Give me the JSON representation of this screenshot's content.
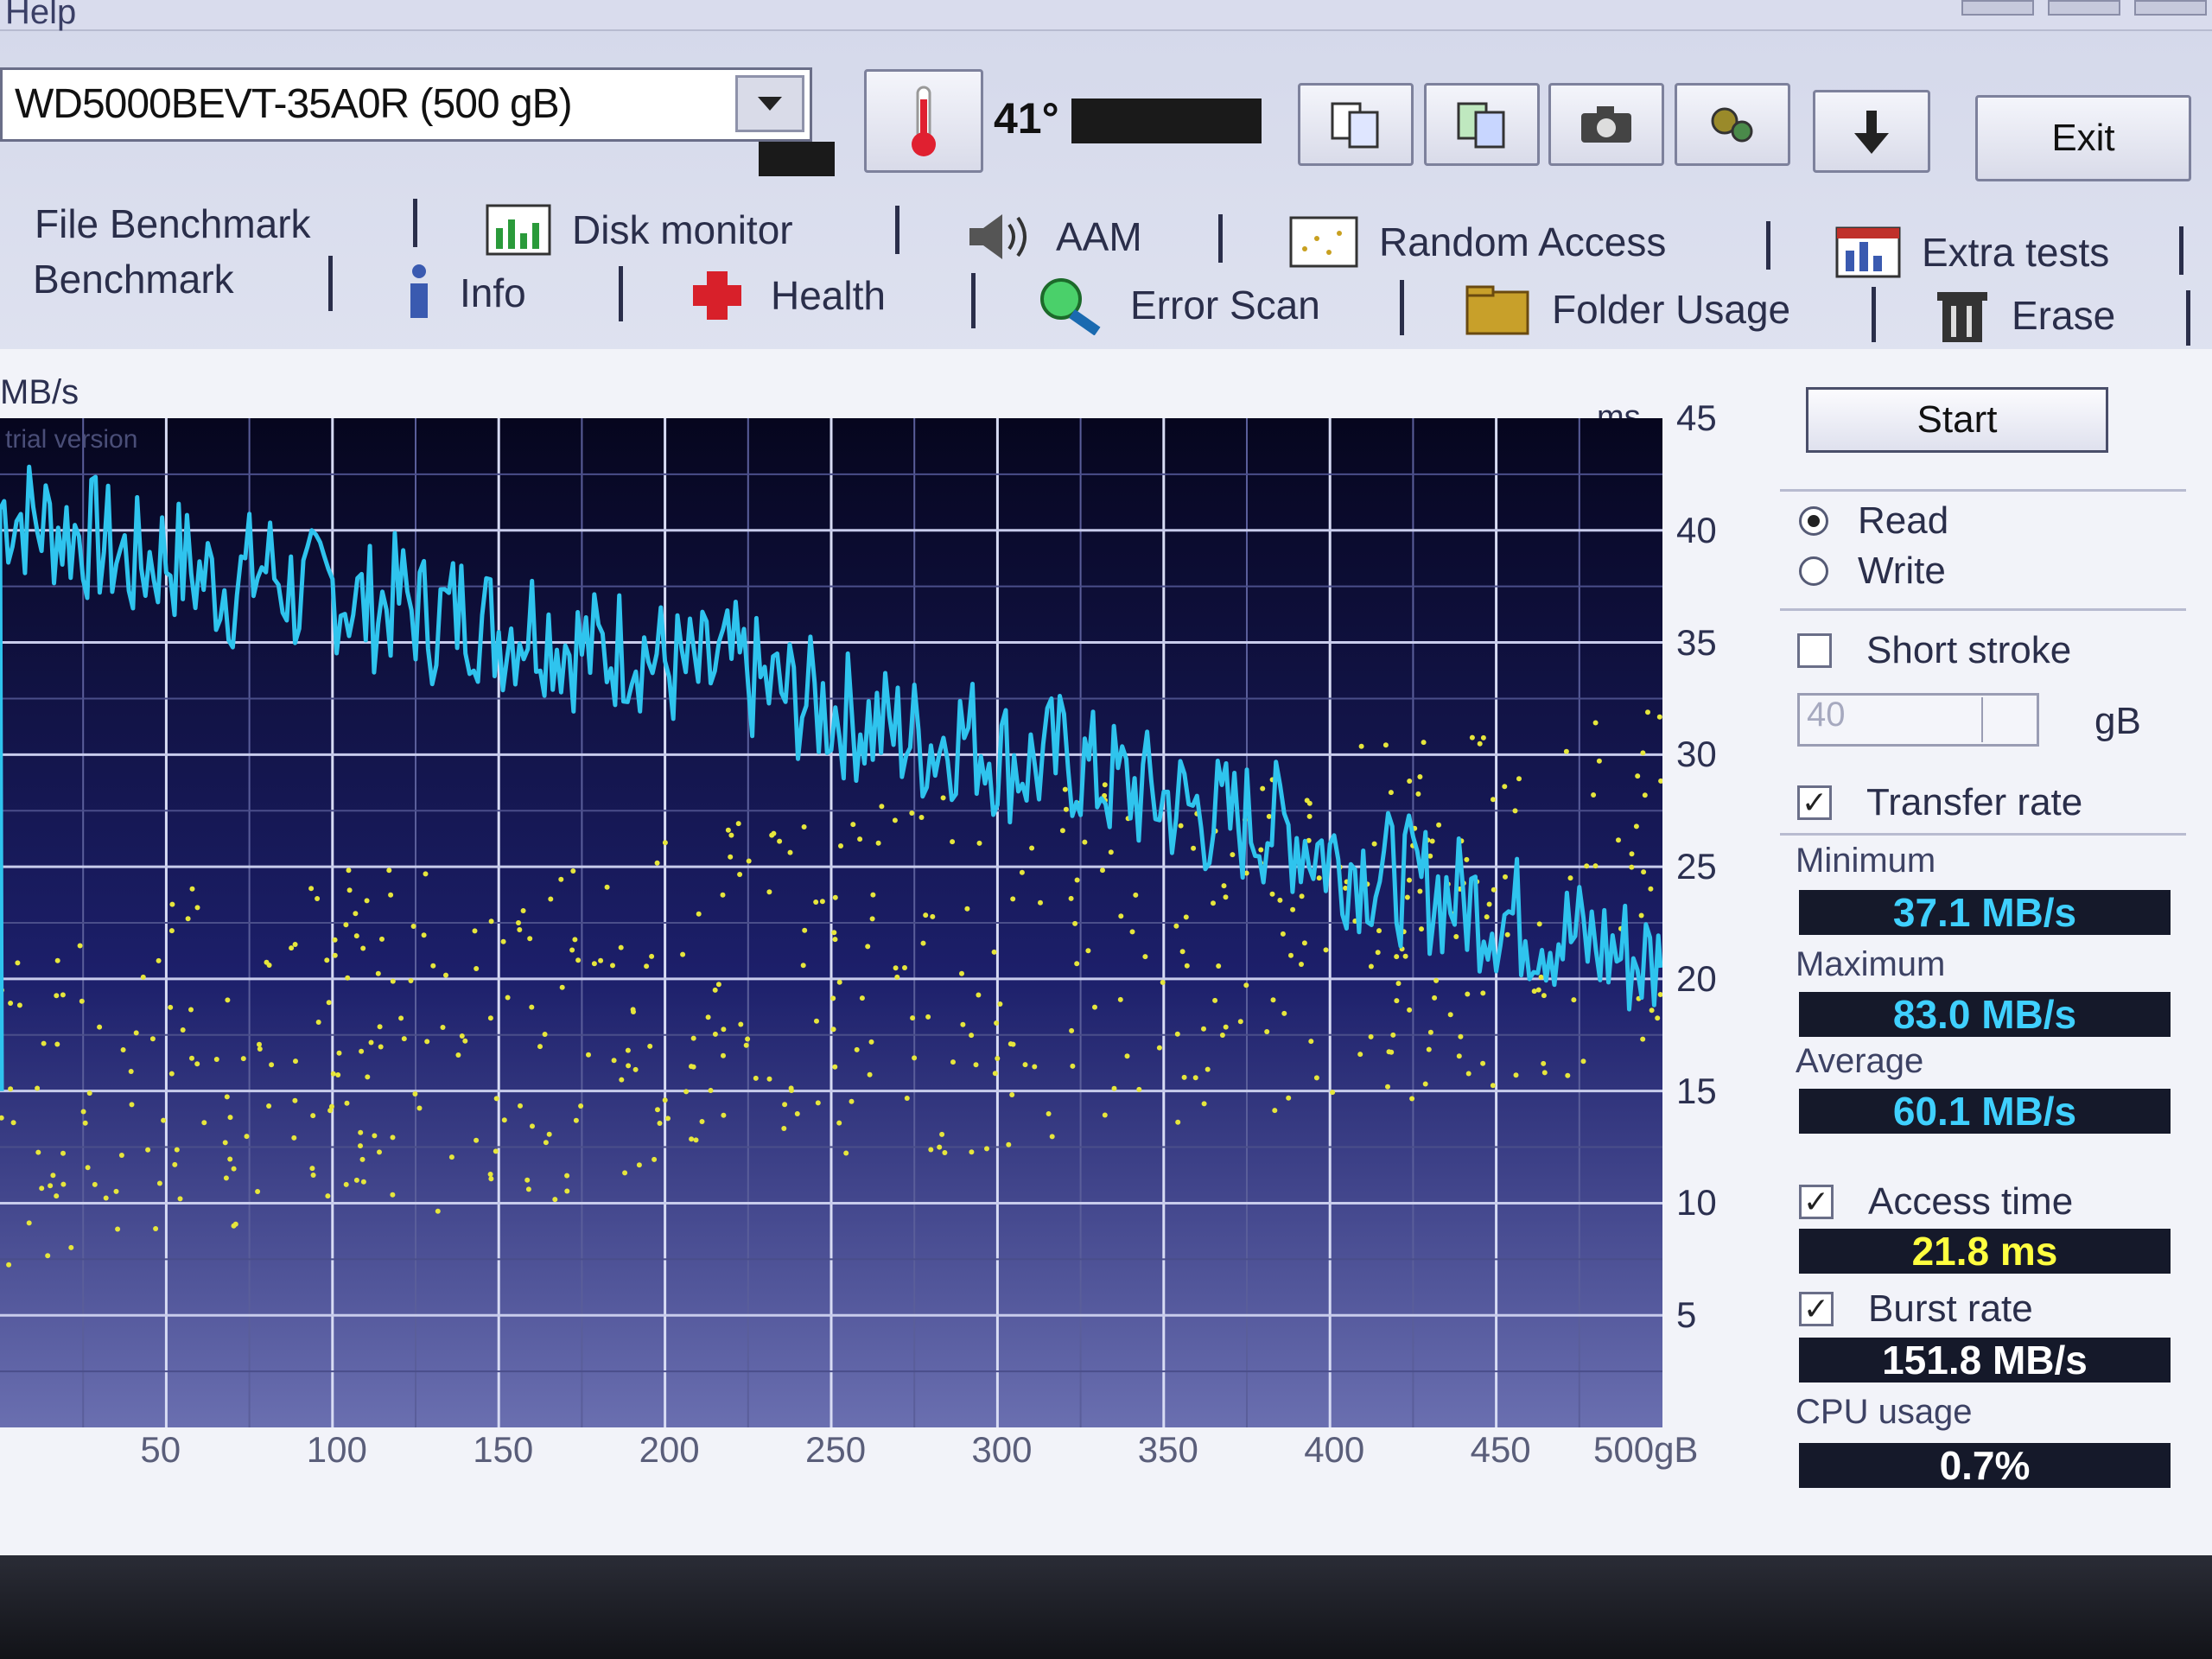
{
  "menu": {
    "help": "Help"
  },
  "toolbar": {
    "drive": "WD5000BEVT-35A0R (500 gB)",
    "temperature": "41°",
    "exit": "Exit"
  },
  "tabs": {
    "row1": [
      "File Benchmark",
      "Disk monitor",
      "AAM",
      "Random Access",
      "Extra tests"
    ],
    "row2": [
      "Benchmark",
      "Info",
      "Health",
      "Error Scan",
      "Folder Usage",
      "Erase"
    ]
  },
  "chart": {
    "left_unit": "MB/s",
    "right_unit": "ms",
    "watermark": "trial version",
    "right_ticks": [
      "45",
      "40",
      "35",
      "30",
      "25",
      "20",
      "15",
      "10",
      "5"
    ],
    "x_ticks": [
      "50",
      "100",
      "150",
      "200",
      "250",
      "300",
      "350",
      "400",
      "450",
      "500gB"
    ]
  },
  "chart_data": {
    "type": "line",
    "xlabel": "",
    "ylabel": "MB/s",
    "y2label": "ms",
    "xlim": [
      0,
      500
    ],
    "y2lim": [
      0,
      45
    ],
    "series": [
      {
        "x": [
          0,
          10,
          20,
          30,
          40,
          50,
          60,
          70,
          80,
          90,
          100,
          110,
          120,
          130,
          140,
          150,
          160,
          170,
          180,
          190,
          200,
          210,
          220,
          230,
          240,
          250,
          260,
          270,
          280,
          290,
          300,
          310,
          320,
          330,
          340,
          350,
          360,
          370,
          380,
          390,
          400,
          410,
          420,
          430,
          440,
          450,
          460,
          470,
          480,
          490,
          500
        ],
        "y": [
          82,
          81,
          80,
          79,
          77,
          78,
          76,
          75,
          77,
          74,
          75,
          73,
          74,
          72,
          73,
          71,
          72,
          70,
          69,
          70,
          68,
          67,
          68,
          66,
          65,
          64,
          63,
          62,
          61,
          62,
          60,
          59,
          60,
          58,
          57,
          56,
          55,
          54,
          54,
          53,
          51,
          50,
          49,
          48,
          47,
          46,
          45,
          44,
          43,
          42,
          41
        ]
      }
    ],
    "access_time_scatter": "yellow points, roughly 10–28 ms, spread across capacity"
  },
  "controls": {
    "start": "Start",
    "read": "Read",
    "write": "Write",
    "short_stroke": "Short stroke",
    "stroke_value": "40",
    "stroke_unit": "gB",
    "transfer_rate": "Transfer rate",
    "access_time": "Access time",
    "burst_rate": "Burst rate"
  },
  "stats": {
    "minimum_label": "Minimum",
    "minimum": "37.1 MB/s",
    "maximum_label": "Maximum",
    "maximum": "83.0 MB/s",
    "average_label": "Average",
    "average": "60.1 MB/s",
    "access_time": "21.8 ms",
    "burst_rate": "151.8 MB/s",
    "cpu_label": "CPU usage",
    "cpu": "0.7%"
  },
  "colors": {
    "transfer_line": "#2fc4ee",
    "access_dots": "#e6e63c",
    "chart_bg": "#0b0b30"
  }
}
